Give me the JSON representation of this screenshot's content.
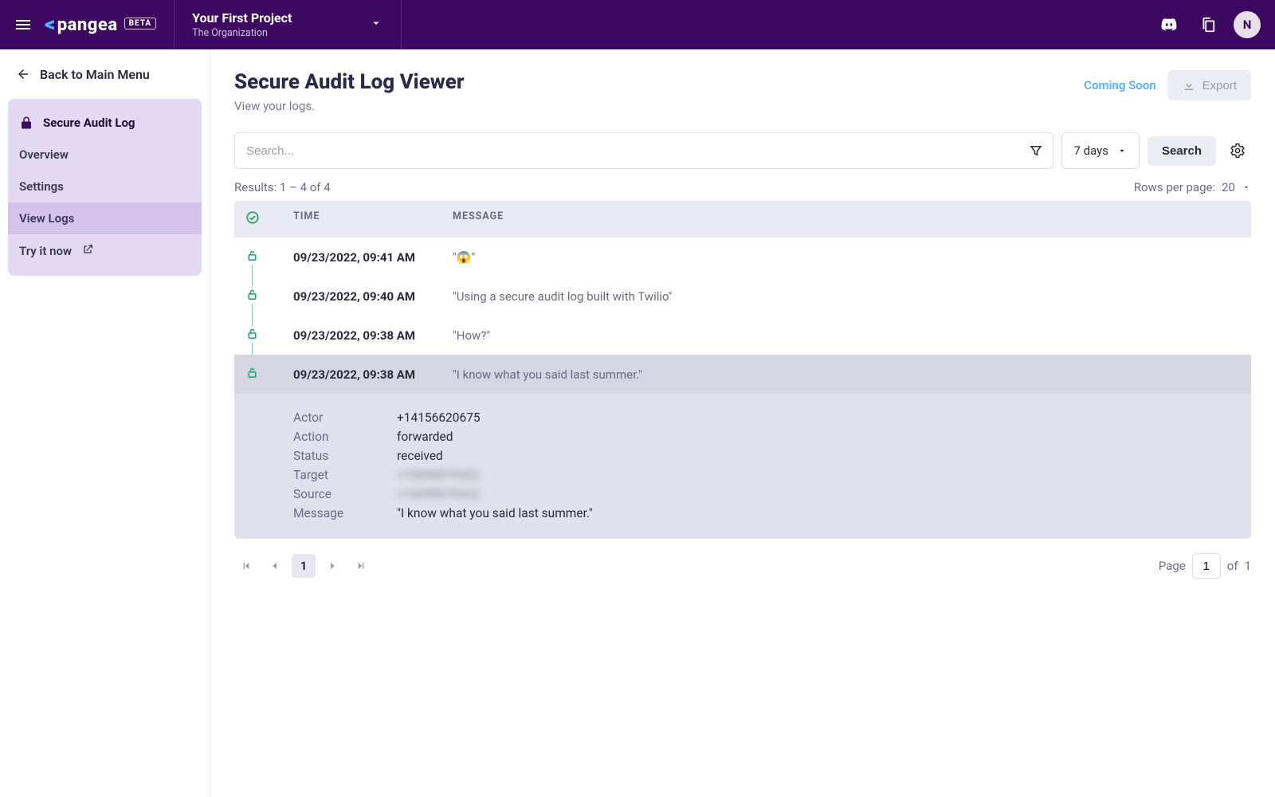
{
  "header": {
    "logo_text": "pangea",
    "beta_label": "BETA",
    "project_title": "Your First Project",
    "org_name": "The Organization",
    "avatar_initial": "N"
  },
  "sidebar": {
    "back_label": "Back to Main Menu",
    "section_title": "Secure Audit Log",
    "items": [
      {
        "label": "Overview"
      },
      {
        "label": "Settings"
      },
      {
        "label": "View Logs"
      },
      {
        "label": "Try it now"
      }
    ]
  },
  "page": {
    "title": "Secure Audit Log Viewer",
    "subtitle": "View your logs.",
    "coming_soon": "Coming Soon",
    "export_label": "Export",
    "search_placeholder": "Search...",
    "range_label": "7 days",
    "search_btn": "Search",
    "results_text": "Results: 1 – 4 of 4",
    "rows_per_page_label": "Rows per page:",
    "rows_per_page_value": "20"
  },
  "table": {
    "columns": {
      "time": "TIME",
      "message": "MESSAGE"
    },
    "rows": [
      {
        "time": "09/23/2022, 09:41 AM",
        "message": "\"😱\""
      },
      {
        "time": "09/23/2022, 09:40 AM",
        "message": "\"Using a secure audit log built with Twilio\""
      },
      {
        "time": "09/23/2022, 09:38 AM",
        "message": "\"How?\""
      },
      {
        "time": "09/23/2022, 09:38 AM",
        "message": "\"I know what you said last summer.\""
      }
    ]
  },
  "details": {
    "fields": [
      {
        "key": "Actor",
        "value": "+14156620675"
      },
      {
        "key": "Action",
        "value": "forwarded"
      },
      {
        "key": "Status",
        "value": "received"
      },
      {
        "key": "Target",
        "value": "+10098076322",
        "blurred": true
      },
      {
        "key": "Source",
        "value": "+10098076322",
        "blurred": true
      },
      {
        "key": "Message",
        "value": "\"I know what you said last summer.\""
      }
    ]
  },
  "pagination": {
    "current": "1",
    "page_label": "Page",
    "page_input": "1",
    "of_label": "of",
    "total": "1"
  }
}
